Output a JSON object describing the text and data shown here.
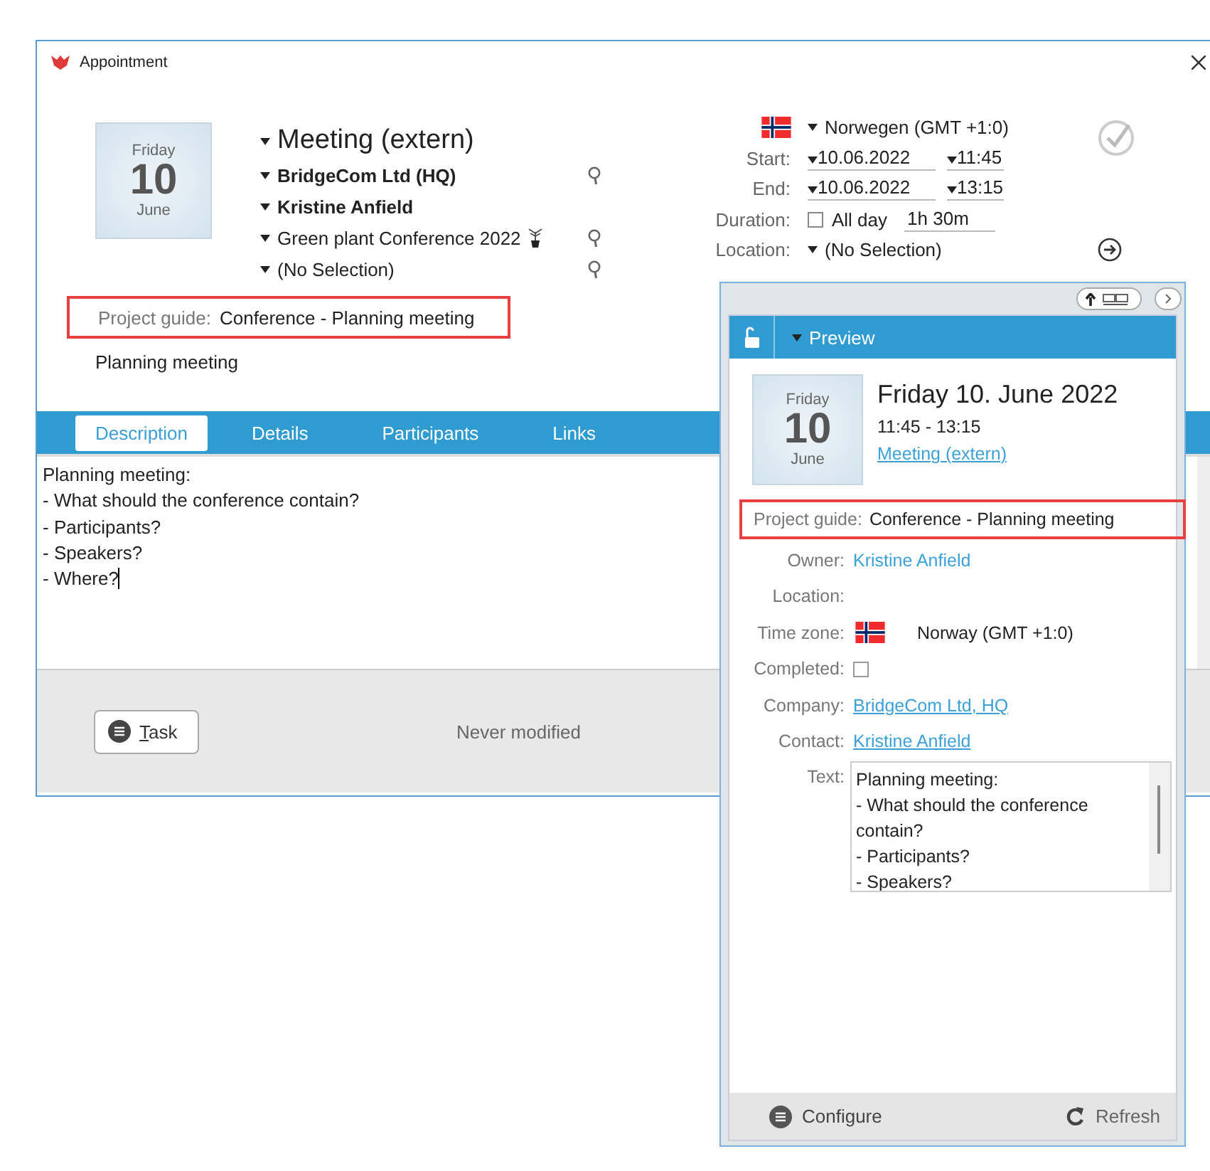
{
  "window": {
    "title": "Appointment"
  },
  "appointment": {
    "date_tile": {
      "weekday": "Friday",
      "day": "10",
      "month": "June"
    },
    "type": "Meeting (extern)",
    "company": "BridgeCom Ltd (HQ)",
    "contact": "Kristine Anfield",
    "project": "Green plant Conference 2022",
    "selection": "(No Selection)",
    "project_guide": {
      "label": "Project guide:",
      "value": "Conference - Planning meeting"
    },
    "subject": "Planning meeting"
  },
  "schedule": {
    "timezone": "Norwegen (GMT +1:0)",
    "start": {
      "label": "Start:",
      "date": "10.06.2022",
      "time": "11:45"
    },
    "end": {
      "label": "End:",
      "date": "10.06.2022",
      "time": "13:15"
    },
    "duration": {
      "label": "Duration:",
      "all_day": {
        "label": "All day",
        "checked": false
      },
      "value": "1h 30m"
    },
    "location": {
      "label": "Location:",
      "value": "(No Selection)"
    }
  },
  "tabs": [
    {
      "label": "Description",
      "selected": true
    },
    {
      "label": "Details",
      "selected": false
    },
    {
      "label": "Participants",
      "selected": false
    },
    {
      "label": "Links",
      "selected": false
    }
  ],
  "description": "Planning meeting:\n- What should the conference contain?\n- Participants?\n- Speakers?\n- Where?",
  "footer": {
    "task_button": "Task",
    "status": "Never modified"
  },
  "preview": {
    "header": "Preview",
    "date_tile": {
      "weekday": "Friday",
      "day": "10",
      "month": "June"
    },
    "title": "Friday 10. June 2022",
    "time": "11:45 - 13:15",
    "type_link": "Meeting (extern)",
    "project_guide": {
      "label": "Project guide:",
      "value": "Conference - Planning meeting"
    },
    "fields": [
      {
        "kind": "name",
        "label": "Owner:",
        "value": "Kristine Anfield"
      },
      {
        "kind": "empty",
        "label": "Location:"
      },
      {
        "kind": "timezone",
        "label": "Time zone:",
        "value": "Norway (GMT +1:0)"
      },
      {
        "kind": "checkbox",
        "label": "Completed:",
        "checked": false
      },
      {
        "kind": "link",
        "label": "Company:",
        "value": "BridgeCom Ltd, HQ"
      },
      {
        "kind": "link",
        "label": "Contact:",
        "value": "Kristine Anfield"
      }
    ],
    "text": {
      "label": "Text:",
      "value": "Planning meeting:\n- What should the conference contain?\n- Participants?\n- Speakers?"
    },
    "configure": "Configure",
    "refresh": "Refresh"
  }
}
